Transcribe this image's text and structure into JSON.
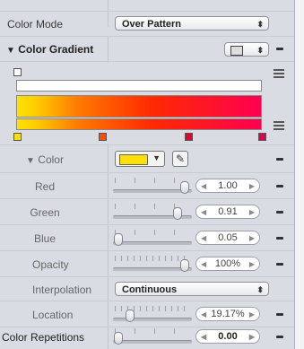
{
  "colors": {
    "gradient_start": "#ffe000",
    "gradient_mid": "#ff2a00",
    "gradient_end": "#ff0050",
    "swatch": "#ffe000"
  },
  "color_mode": {
    "label": "Color Mode",
    "value": "Over Pattern"
  },
  "color_gradient": {
    "label": "Color Gradient",
    "disclosure": "▼"
  },
  "color": {
    "label": "Color",
    "disclosure": "▼"
  },
  "red": {
    "label": "Red",
    "value": "1.00"
  },
  "green": {
    "label": "Green",
    "value": "0.91"
  },
  "blue": {
    "label": "Blue",
    "value": "0.05"
  },
  "opacity": {
    "label": "Opacity",
    "value": "100%"
  },
  "interpolation": {
    "label": "Interpolation",
    "value": "Continuous"
  },
  "location": {
    "label": "Location",
    "value": "19.17%"
  },
  "color_repetitions": {
    "label": "Color Repetitions",
    "value": "0.00"
  },
  "icons": {
    "popup_arrows": "up-down-arrows",
    "eyedropper": "eyedropper-icon",
    "stepper_left": "◀",
    "stepper_right": "▶"
  }
}
